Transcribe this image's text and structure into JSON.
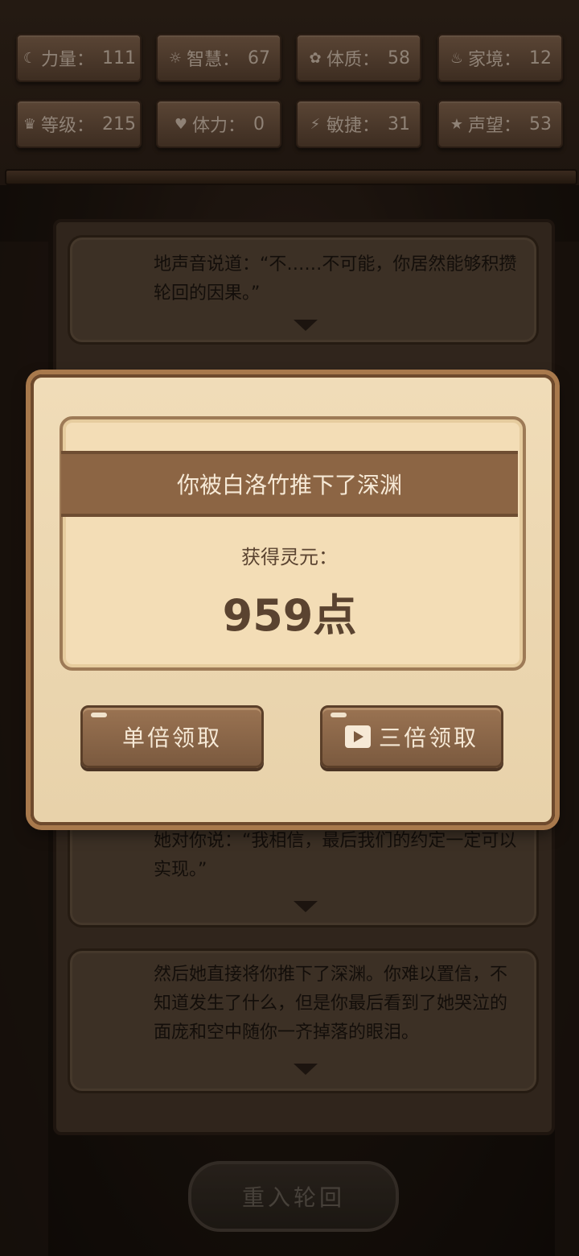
{
  "stats": [
    {
      "icon": "strength-icon",
      "glyph": "☾",
      "label": "力量：",
      "value": "111"
    },
    {
      "icon": "wisdom-icon",
      "glyph": "☼",
      "label": "智慧：",
      "value": "67"
    },
    {
      "icon": "constitution-icon",
      "glyph": "✿",
      "label": "体质：",
      "value": "58"
    },
    {
      "icon": "family-icon",
      "glyph": "♨",
      "label": "家境：",
      "value": "12"
    },
    {
      "icon": "level-icon",
      "glyph": "♛",
      "label": "等级：",
      "value": "215"
    },
    {
      "icon": "stamina-icon",
      "glyph": "♥",
      "label": "体力：",
      "value": "0"
    },
    {
      "icon": "agility-icon",
      "glyph": "⚡",
      "label": "敏捷：",
      "value": "31"
    },
    {
      "icon": "reputation-icon",
      "glyph": "★",
      "label": "声望：",
      "value": "53"
    }
  ],
  "story": [
    {
      "text": "地声音说道：“不……不可能，你居然能够积攒轮回的因果。”"
    },
    {
      "text": "她对你说：“我相信，最后我们的约定一定可以实现。”"
    },
    {
      "text": "然后她直接将你推下了深渊。你难以置信，不知道发生了什么，但是你最后看到了她哭泣的面庞和空中随你一齐掉落的眼泪。"
    }
  ],
  "modal": {
    "title": "你被白洛竹推下了深渊",
    "gain_label": "获得灵元：",
    "gain_amount": "959点",
    "single_button": "单倍领取",
    "triple_button": "三倍领取"
  },
  "rebirth_button": "重入轮回"
}
